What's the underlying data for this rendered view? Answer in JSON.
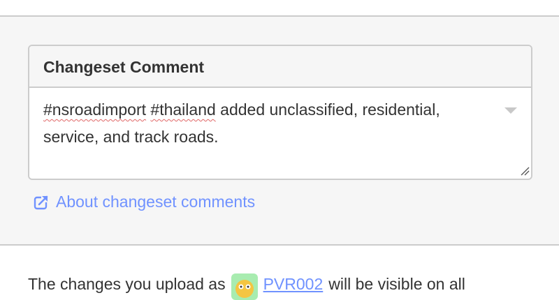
{
  "changeset": {
    "header_title": "Changeset Comment",
    "comment_tag_1": "#nsroadimport",
    "comment_space_1": " ",
    "comment_tag_2": "#thailand",
    "comment_rest": " added unclassified, residential, service, and track roads."
  },
  "about_link": {
    "label": "About changeset comments",
    "icon": "external-link-icon"
  },
  "upload_notice": {
    "prefix": "The changes you upload as",
    "username": "PVR002",
    "suffix": "will be visible on all"
  },
  "colors": {
    "link": "#7092ff",
    "panel_background": "#f6f6f6",
    "border": "#cccccc",
    "avatar_background": "#a8ecb0"
  }
}
